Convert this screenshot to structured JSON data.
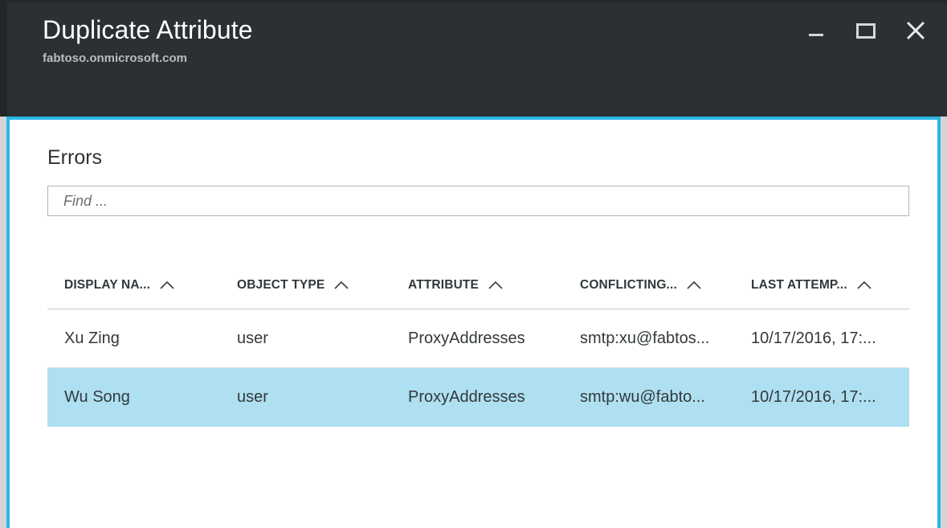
{
  "window": {
    "title": "Duplicate Attribute",
    "subtitle": "fabtoso.onmicrosoft.com",
    "controls": {
      "minimize_label": "Minimize",
      "maximize_label": "Maximize",
      "close_label": "Close"
    }
  },
  "content": {
    "section_title": "Errors",
    "search": {
      "value": "",
      "placeholder": "Find ..."
    },
    "table": {
      "columns": [
        {
          "label": "DISPLAY NA...",
          "sort_icon": "chevron-up-icon"
        },
        {
          "label": "OBJECT TYPE",
          "sort_icon": "chevron-up-icon"
        },
        {
          "label": "ATTRIBUTE",
          "sort_icon": "chevron-up-icon"
        },
        {
          "label": "CONFLICTING...",
          "sort_icon": "chevron-up-icon"
        },
        {
          "label": "LAST ATTEMP...",
          "sort_icon": "chevron-up-icon"
        }
      ],
      "rows": [
        {
          "selected": false,
          "cells": [
            "Xu Zing",
            "user",
            "ProxyAddresses",
            "smtp:xu@fabtos...",
            "10/17/2016, 17:..."
          ]
        },
        {
          "selected": true,
          "cells": [
            "Wu Song",
            "user",
            "ProxyAddresses",
            "smtp:wu@fabto...",
            "10/17/2016, 17:..."
          ]
        }
      ]
    }
  },
  "colors": {
    "titlebar_bg": "#2b3034",
    "accent_border": "#29b8e8",
    "selected_row": "#aee0f1",
    "gutter": "#d4d4d4",
    "text_primary": "#33383b",
    "subtitle": "#b9bcbe"
  }
}
